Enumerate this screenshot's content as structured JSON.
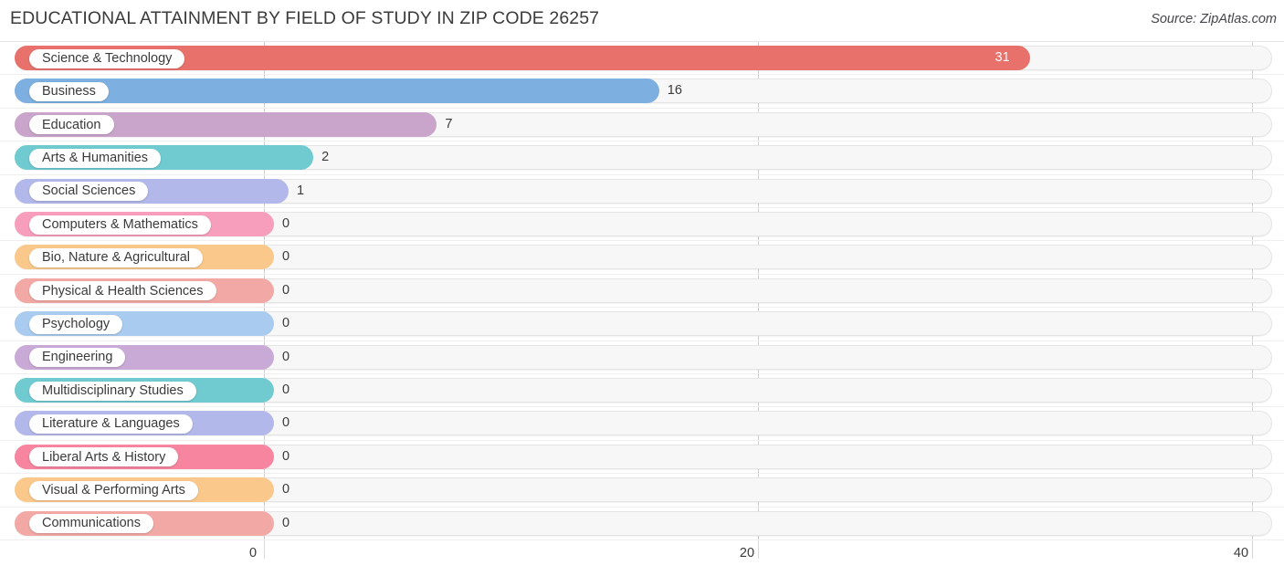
{
  "header": {
    "title": "EDUCATIONAL ATTAINMENT BY FIELD OF STUDY IN ZIP CODE 26257",
    "source": "Source: ZipAtlas.com"
  },
  "chart_data": {
    "type": "bar",
    "orientation": "horizontal",
    "title": "EDUCATIONAL ATTAINMENT BY FIELD OF STUDY IN ZIP CODE 26257",
    "subtitle": "",
    "xlabel": "",
    "ylabel": "",
    "xlim": [
      0,
      40
    ],
    "grid": true,
    "legend": "none",
    "xticks": [
      "0",
      "20",
      "40"
    ],
    "xtick_values": [
      0,
      20,
      40
    ],
    "categories": [
      "Science & Technology",
      "Business",
      "Education",
      "Arts & Humanities",
      "Social Sciences",
      "Computers & Mathematics",
      "Bio, Nature & Agricultural",
      "Physical & Health Sciences",
      "Psychology",
      "Engineering",
      "Multidisciplinary Studies",
      "Literature & Languages",
      "Liberal Arts & History",
      "Visual & Performing Arts",
      "Communications"
    ],
    "values": [
      31,
      16,
      7,
      2,
      1,
      0,
      0,
      0,
      0,
      0,
      0,
      0,
      0,
      0,
      0
    ],
    "value_labels": [
      "31",
      "16",
      "7",
      "2",
      "1",
      "0",
      "0",
      "0",
      "0",
      "0",
      "0",
      "0",
      "0",
      "0",
      "0"
    ],
    "colors": [
      "#e8726b",
      "#7db0e0",
      "#c9a4cb",
      "#6fcbd0",
      "#b3b8ea",
      "#f79ebc",
      "#fbc88b",
      "#f2a9a5",
      "#a9cbef",
      "#c9a9d6",
      "#6fcbd0",
      "#b3b8ea",
      "#f7859f",
      "#fbc88b",
      "#f2a9a5"
    ]
  }
}
